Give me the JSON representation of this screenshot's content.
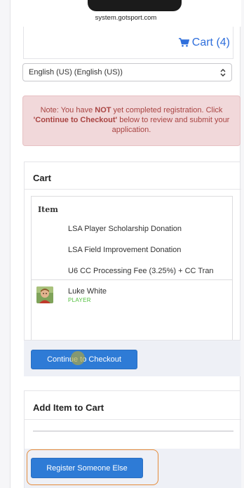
{
  "browser": {
    "url": "system.gotsport.com"
  },
  "header": {
    "cart_label": "Cart (4)"
  },
  "language_select": {
    "value": "English (US) (English (US))"
  },
  "alert": {
    "prefix": "Note: You have ",
    "not": "NOT",
    "mid": " yet completed registration. Click ",
    "cta": "'Continue to Checkout'",
    "suffix": " below to review and submit your application."
  },
  "cart": {
    "title": "Cart",
    "column_item": "Item",
    "items": [
      "LSA Player Scholarship Donation",
      "LSA Field Improvement Donation",
      "U6 CC Processing Fee (3.25%) + CC Tran"
    ],
    "player": {
      "name": "Luke White",
      "role": "PLAYER"
    },
    "checkout_label": "Continue to Checkout"
  },
  "add_item": {
    "title": "Add Item to Cart",
    "register_label": "Register Someone Else"
  },
  "colors": {
    "primary": "#2e7bd6",
    "alert_bg": "#f1d8da",
    "alert_text": "#a94442",
    "player_role": "#4fbf3a",
    "highlight": "#e58b3a"
  }
}
